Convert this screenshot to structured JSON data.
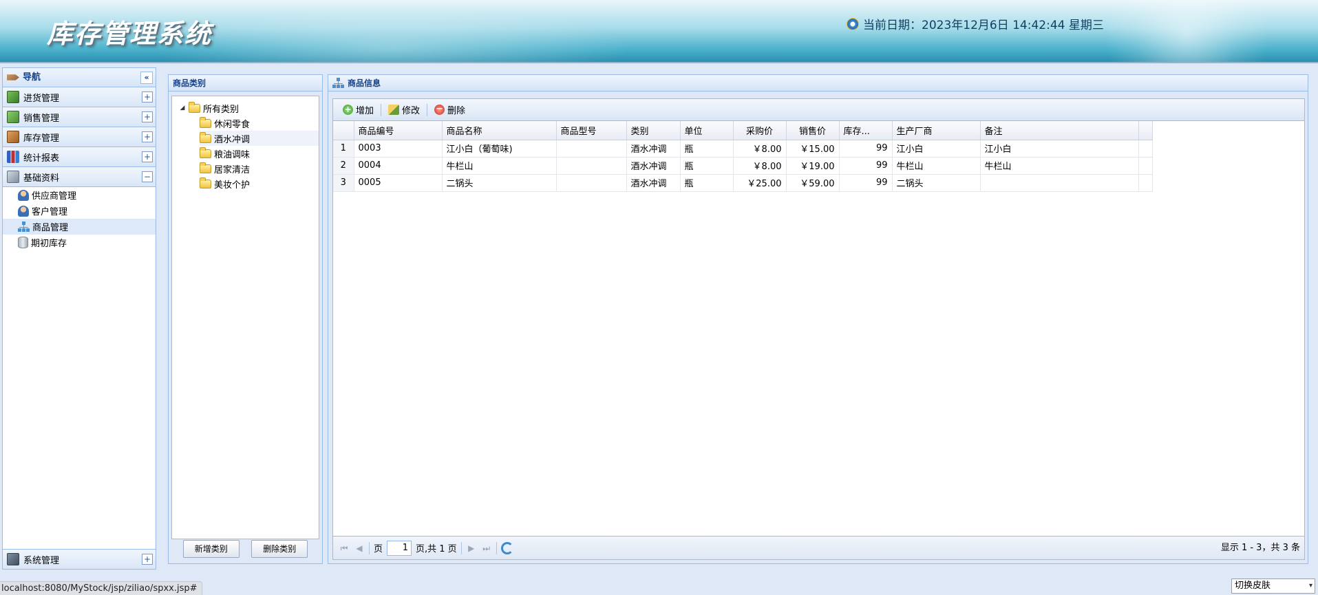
{
  "header": {
    "title": "库存管理系统",
    "date_label": "当前日期：2023年12月6日 14:42:44 星期三"
  },
  "nav": {
    "title": "导航",
    "collapse_glyph": "«",
    "sections": [
      {
        "label": "进货管理",
        "icon": "purchase-icon",
        "toggle": "+"
      },
      {
        "label": "销售管理",
        "icon": "sales-icon",
        "toggle": "+"
      },
      {
        "label": "库存管理",
        "icon": "stock-icon",
        "toggle": "+"
      },
      {
        "label": "统计报表",
        "icon": "report-icon",
        "toggle": "+"
      },
      {
        "label": "基础资料",
        "icon": "basic-data-icon",
        "toggle": "−"
      }
    ],
    "basic_items": [
      {
        "label": "供应商管理",
        "icon": "user-icon"
      },
      {
        "label": "客户管理",
        "icon": "user-icon"
      },
      {
        "label": "商品管理",
        "icon": "tree-icon",
        "selected": true
      },
      {
        "label": "期初库存",
        "icon": "database-icon"
      }
    ],
    "system": {
      "label": "系统管理",
      "toggle": "+"
    }
  },
  "category_panel": {
    "title": "商品类别",
    "root": "所有类别",
    "root_toggle": "◢",
    "children": [
      "休闲零食",
      "酒水冲调",
      "粮油调味",
      "居家清洁",
      "美妆个护"
    ],
    "selected_index": 1,
    "add_button": "新增类别",
    "delete_button": "删除类别"
  },
  "product_panel": {
    "title": "商品信息",
    "toolbar": {
      "add": "增加",
      "edit": "修改",
      "delete": "删除",
      "add_glyph": "+",
      "delete_glyph": "−"
    },
    "columns": [
      "商品编号",
      "商品名称",
      "商品型号",
      "类别",
      "单位",
      "采购价",
      "销售价",
      "库存...",
      "生产厂商",
      "备注"
    ],
    "rows": [
      {
        "n": "1",
        "code": "0003",
        "name": "江小白（葡萄味)",
        "model": "",
        "category": "酒水冲调",
        "unit": "瓶",
        "purchase": "￥8.00",
        "sale": "￥15.00",
        "stock": "99",
        "maker": "江小白",
        "remark": "江小白"
      },
      {
        "n": "2",
        "code": "0004",
        "name": "牛栏山",
        "model": "",
        "category": "酒水冲调",
        "unit": "瓶",
        "purchase": "￥8.00",
        "sale": "￥19.00",
        "stock": "99",
        "maker": "牛栏山",
        "remark": "牛栏山"
      },
      {
        "n": "3",
        "code": "0005",
        "name": "二锅头",
        "model": "",
        "category": "酒水冲调",
        "unit": "瓶",
        "purchase": "￥25.00",
        "sale": "￥59.00",
        "stock": "99",
        "maker": "二锅头",
        "remark": ""
      }
    ],
    "pager": {
      "first": "⏮",
      "prev": "◀",
      "next": "▶",
      "last": "⏭",
      "page_label": "页",
      "page_value": "1",
      "of_label": "页,共 1 页",
      "info": "显示 1 - 3，共 3 条"
    }
  },
  "status_bar": {
    "url": "localhost:8080/MyStock/jsp/ziliao/spxx.jsp#",
    "skin_label": "切换皮肤",
    "skin_arrow": "▾"
  }
}
